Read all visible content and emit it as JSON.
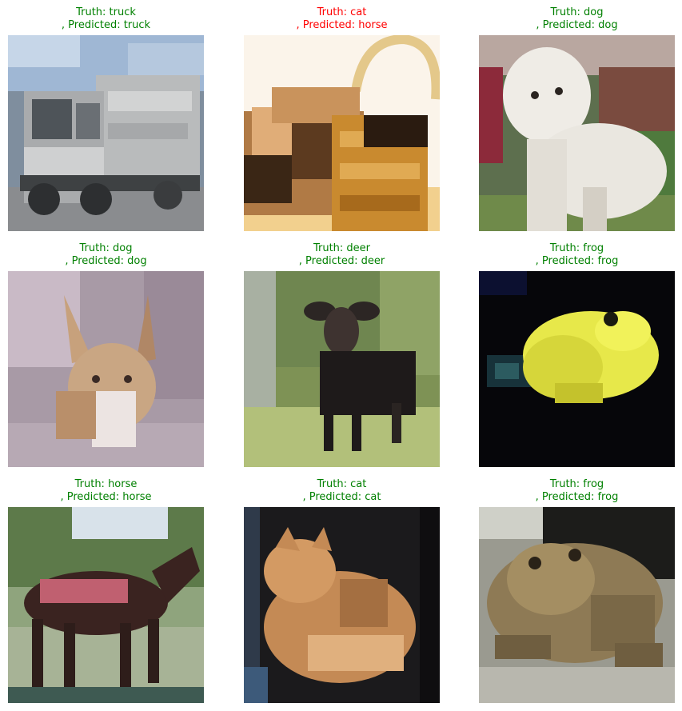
{
  "colors": {
    "correct": "#008000",
    "incorrect": "#ff0000"
  },
  "panels": [
    {
      "truth_text": "Truth: truck",
      "predicted_text": ", Predicted: truck",
      "correct": true,
      "image_desc": "grey garbage truck against a blue sky and grey road"
    },
    {
      "truth_text": "Truth: cat",
      "predicted_text": ", Predicted: horse",
      "correct": false,
      "image_desc": "brown and black kittens inside a woven basket"
    },
    {
      "truth_text": "Truth: dog",
      "predicted_text": ", Predicted: dog",
      "correct": true,
      "image_desc": "white fluffy poodle in front of green foliage"
    },
    {
      "truth_text": "Truth: dog",
      "predicted_text": ", Predicted: dog",
      "correct": true,
      "image_desc": "tan dog with large ears on a pale mauve background"
    },
    {
      "truth_text": "Truth: deer",
      "predicted_text": ", Predicted: deer",
      "correct": true,
      "image_desc": "dark moose standing in green grass beside a tree"
    },
    {
      "truth_text": "Truth: frog",
      "predicted_text": ", Predicted: frog",
      "correct": true,
      "image_desc": "yellow frog on a black background"
    },
    {
      "truth_text": "Truth: horse",
      "predicted_text": ", Predicted: horse",
      "correct": true,
      "image_desc": "dark brown horse with a red saddle cloth on grass"
    },
    {
      "truth_text": "Truth: cat",
      "predicted_text": ", Predicted: cat",
      "correct": true,
      "image_desc": "orange tabby cat lying in a dark box"
    },
    {
      "truth_text": "Truth: frog",
      "predicted_text": ", Predicted: frog",
      "correct": true,
      "image_desc": "brown mottled toad on a grey ground"
    }
  ]
}
